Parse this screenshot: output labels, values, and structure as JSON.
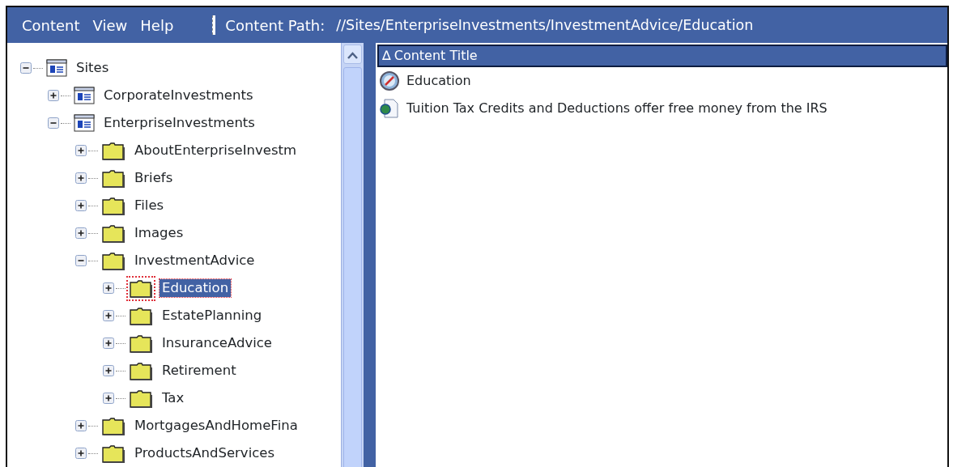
{
  "menu": [
    {
      "label": "Content"
    },
    {
      "label": "View"
    },
    {
      "label": "Help"
    }
  ],
  "content_path": {
    "label": "Content Path:",
    "value": "//Sites/EnterpriseInvestments/InvestmentAdvice/Education"
  },
  "tree": [
    {
      "label": "Sites",
      "kind": "site",
      "expanded": true,
      "selected": false,
      "children": [
        {
          "label": "CorporateInvestments",
          "kind": "site",
          "expanded": false,
          "selected": false
        },
        {
          "label": "EnterpriseInvestments",
          "kind": "site",
          "expanded": true,
          "selected": false,
          "children": [
            {
              "label": "AboutEnterpriseInvestm",
              "kind": "folder",
              "expanded": false,
              "selected": false
            },
            {
              "label": "Briefs",
              "kind": "folder",
              "expanded": false,
              "selected": false
            },
            {
              "label": "Files",
              "kind": "folder",
              "expanded": false,
              "selected": false
            },
            {
              "label": "Images",
              "kind": "folder",
              "expanded": false,
              "selected": false
            },
            {
              "label": "InvestmentAdvice",
              "kind": "folder",
              "expanded": true,
              "selected": false,
              "children": [
                {
                  "label": "Education",
                  "kind": "folder",
                  "expanded": false,
                  "selected": true
                },
                {
                  "label": "EstatePlanning",
                  "kind": "folder",
                  "expanded": false,
                  "selected": false
                },
                {
                  "label": "InsuranceAdvice",
                  "kind": "folder",
                  "expanded": false,
                  "selected": false
                },
                {
                  "label": "Retirement",
                  "kind": "folder",
                  "expanded": false,
                  "selected": false
                },
                {
                  "label": "Tax",
                  "kind": "folder",
                  "expanded": false,
                  "selected": false
                }
              ]
            },
            {
              "label": "MortgagesAndHomeFina",
              "kind": "folder",
              "expanded": false,
              "selected": false
            },
            {
              "label": "ProductsAndServices",
              "kind": "folder",
              "expanded": false,
              "selected": false
            }
          ]
        }
      ]
    }
  ],
  "list": {
    "column": {
      "sort_indicator": "∆",
      "label": "Content Title"
    },
    "items": [
      {
        "kind": "folder",
        "title": "Education"
      },
      {
        "kind": "document",
        "title": "Tuition Tax Credits and Deductions offer free money from the IRS"
      }
    ]
  }
}
